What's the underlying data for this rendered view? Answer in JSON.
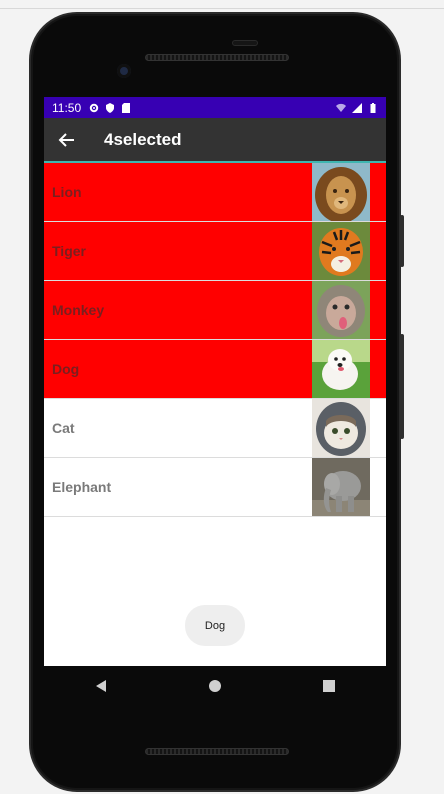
{
  "status_bar": {
    "time": "11:50",
    "left_icons": [
      "settings-icon",
      "shield-icon",
      "sd-card-icon"
    ],
    "right_icons": [
      "wifi-icon",
      "signal-icon",
      "battery-icon"
    ],
    "background": "#3700b3"
  },
  "app_bar": {
    "title": "4selected",
    "back_icon": "arrow-back-icon",
    "background": "#333333"
  },
  "list": {
    "items": [
      {
        "label": "Lion",
        "selected": true,
        "image": "lion-photo"
      },
      {
        "label": "Tiger",
        "selected": true,
        "image": "tiger-photo"
      },
      {
        "label": "Monkey",
        "selected": true,
        "image": "monkey-photo"
      },
      {
        "label": "Dog",
        "selected": true,
        "image": "dog-photo"
      },
      {
        "label": "Cat",
        "selected": false,
        "image": "cat-photo"
      },
      {
        "label": "Elephant",
        "selected": false,
        "image": "elephant-photo"
      }
    ],
    "selected_color": "#ff0000"
  },
  "toast": {
    "text": "Dog"
  },
  "nav_bar": {
    "buttons": [
      "back-triangle-icon",
      "home-circle-icon",
      "recents-square-icon"
    ]
  }
}
